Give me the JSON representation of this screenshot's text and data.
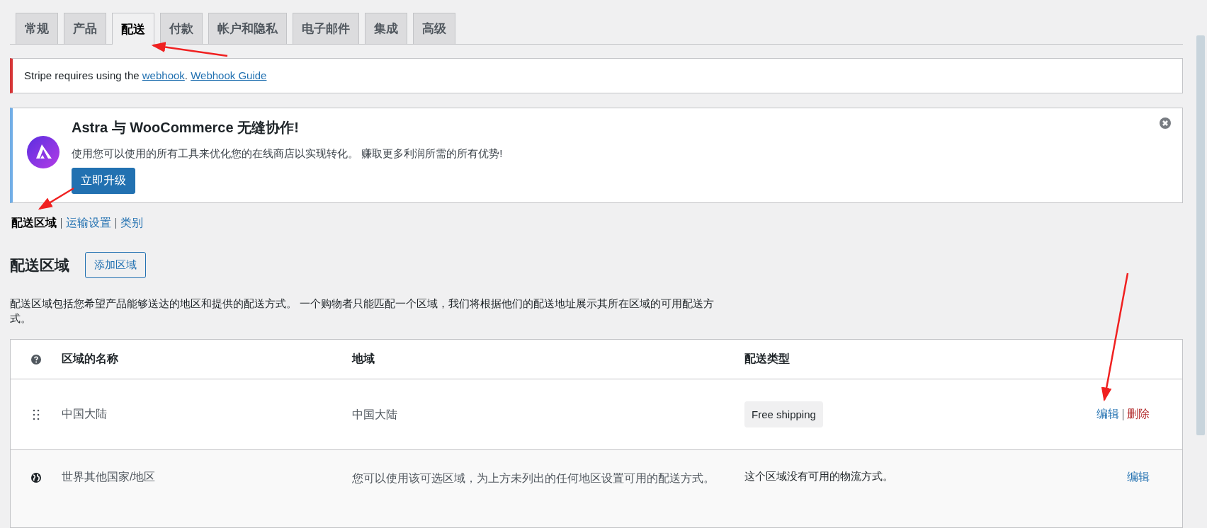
{
  "tabs": [
    {
      "label": "常规",
      "selected": false
    },
    {
      "label": "产品",
      "selected": false
    },
    {
      "label": "配送",
      "selected": true
    },
    {
      "label": "付款",
      "selected": false
    },
    {
      "label": "帐户和隐私",
      "selected": false
    },
    {
      "label": "电子邮件",
      "selected": false
    },
    {
      "label": "集成",
      "selected": false
    },
    {
      "label": "高级",
      "selected": false
    }
  ],
  "stripe_notice": {
    "text": "Stripe requires using the ",
    "link": "webhook",
    "separator": ". ",
    "guide_link": "Webhook Guide"
  },
  "promo": {
    "title": "Astra 与 WooCommerce 无缝协作!",
    "description": "使用您可以使用的所有工具来优化您的在线商店以实现转化。 赚取更多利润所需的所有优势!",
    "button": "立即升级"
  },
  "subnav": [
    {
      "label": "配送区域",
      "selected": true
    },
    {
      "label": "运输设置",
      "selected": false
    },
    {
      "label": "类别",
      "selected": false
    }
  ],
  "heading": "配送区域",
  "add_button": "添加区域",
  "description": "配送区域包括您希望产品能够送达的地区和提供的配送方式。 一个购物者只能匹配一个区域，我们将根据他们的配送地址展示其所在区域的可用配送方式。",
  "table": {
    "columns": [
      "区域的名称",
      "地域",
      "配送类型"
    ],
    "rows": [
      {
        "kind": "zone",
        "name": "中国大陆",
        "region": "中国大陆",
        "methods": [
          "Free shipping"
        ],
        "actions": [
          {
            "label": "编辑",
            "kind": "edit"
          },
          {
            "label": "删除",
            "kind": "delete"
          }
        ]
      },
      {
        "kind": "fallback",
        "name": "世界其他国家/地区",
        "region": "您可以使用该可选区域，为上方未列出的任何地区设置可用的配送方式。",
        "note": "这个区域没有可用的物流方式。",
        "actions": [
          {
            "label": "编辑",
            "kind": "edit"
          }
        ]
      }
    ]
  }
}
